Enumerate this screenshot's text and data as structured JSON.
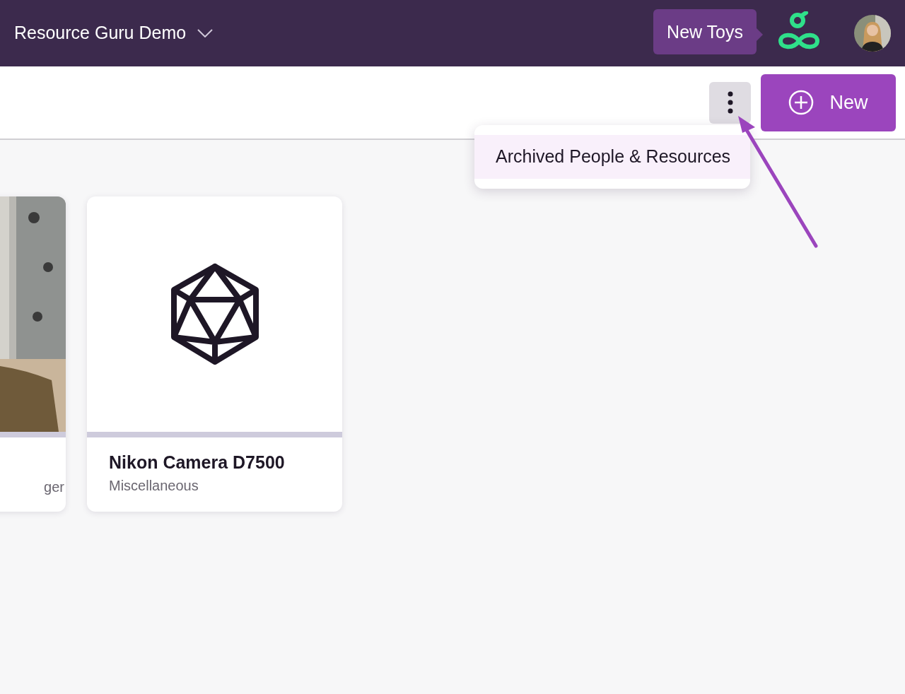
{
  "header": {
    "workspace": "Resource Guru Demo",
    "tooltip": "New Toys"
  },
  "toolbar": {
    "new_button": "New"
  },
  "menu": {
    "items": [
      {
        "label": "Archived People & Resources",
        "selected": true
      }
    ]
  },
  "cards": [
    {
      "kind": "picture",
      "subtitle": "ger"
    },
    {
      "kind": "icon",
      "name": "Nikon Camera D7500",
      "subtitle": "Miscellaneous"
    }
  ]
}
